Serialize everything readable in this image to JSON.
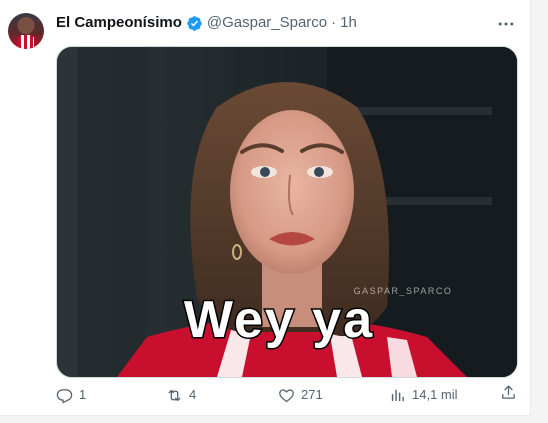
{
  "author": {
    "display_name": "El Campeonísimo",
    "handle": "@Gaspar_Sparco",
    "separator": "·",
    "time": "1h",
    "verified": true
  },
  "media": {
    "caption": "Wey ya",
    "watermark": "GASPAR_SPARCO"
  },
  "actions": {
    "reply_count": "1",
    "retweet_count": "4",
    "like_count": "271",
    "views_count": "14,1 mil"
  },
  "colors": {
    "verified_blue": "#1d9bf0",
    "muted_text": "#536471",
    "jersey_red": "#c8102e"
  },
  "icons": [
    "verified-badge-icon",
    "more-icon",
    "reply-icon",
    "retweet-icon",
    "like-icon",
    "views-icon",
    "share-icon"
  ]
}
